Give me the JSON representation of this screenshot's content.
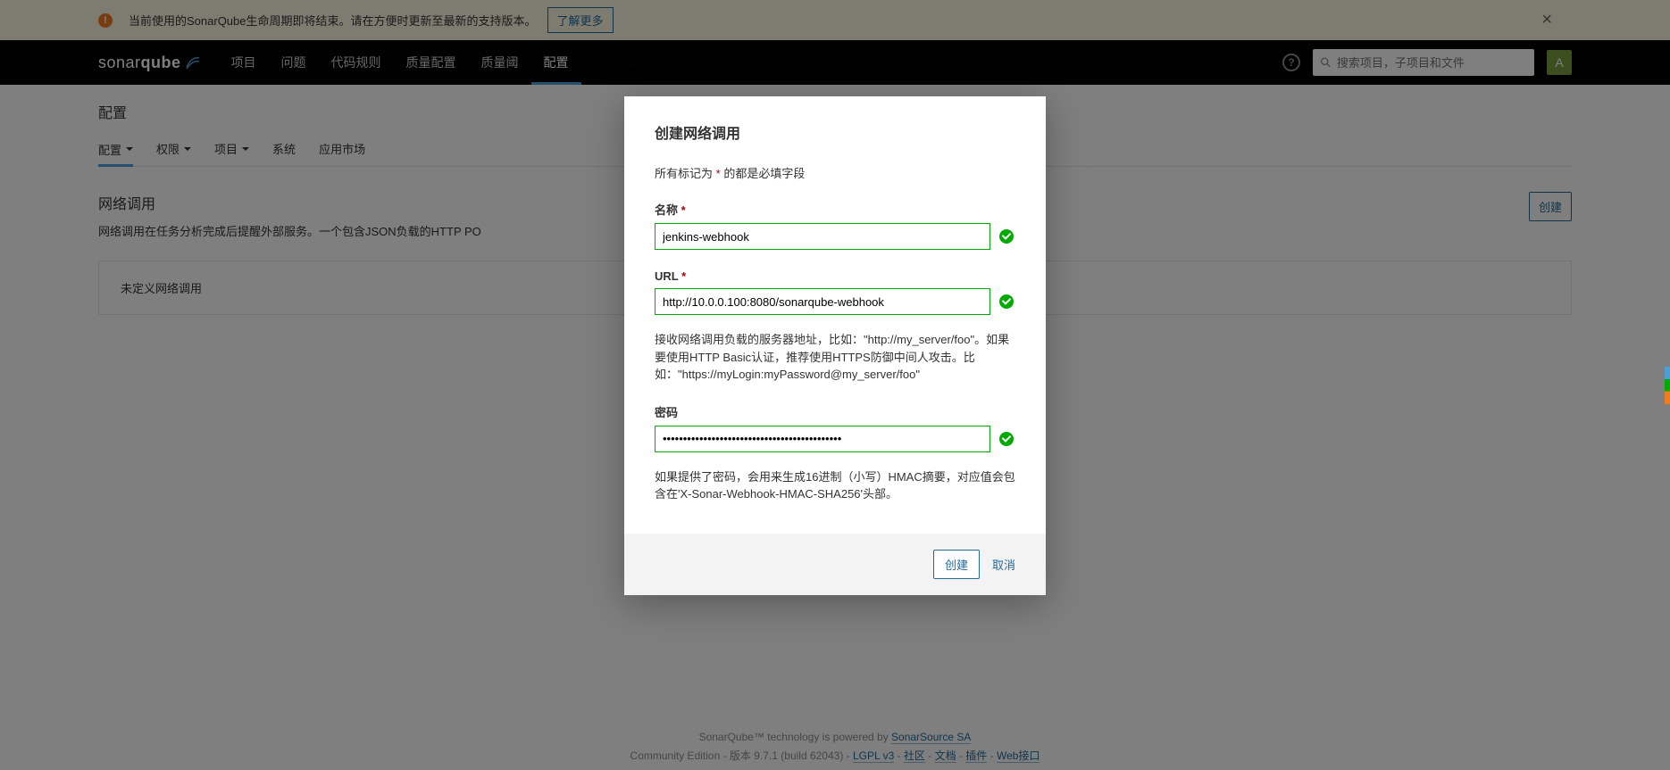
{
  "banner": {
    "text": "当前使用的SonarQube生命周期即将结束。请在方便时更新至最新的支持版本。",
    "learn_more": "了解更多"
  },
  "topnav": {
    "logo_part1": "sonar",
    "logo_part2": "qube",
    "items": [
      "项目",
      "问题",
      "代码规则",
      "质量配置",
      "质量阈",
      "配置"
    ],
    "active_index": 5,
    "search_placeholder": "搜索项目，子项目和文件",
    "avatar_letter": "A"
  },
  "page": {
    "title": "配置",
    "subnav": [
      "配置",
      "权限",
      "项目",
      "系统",
      "应用市场"
    ],
    "subnav_dropdown": [
      true,
      true,
      true,
      false,
      false
    ],
    "subnav_active_index": 0,
    "section_title": "网络调用",
    "section_desc": "网络调用在任务分析完成后提醒外部服务。一个包含JSON负载的HTTP PO",
    "create_button": "创建",
    "empty_message": "未定义网络调用"
  },
  "modal": {
    "title": "创建网络调用",
    "required_prefix": "所有标记为",
    "required_suffix": "的都是必填字段",
    "name_label": "名称",
    "name_value": "jenkins-webhook",
    "url_label": "URL",
    "url_value": "http://10.0.0.100:8080/sonarqube-webhook",
    "url_help": "接收网络调用负载的服务器地址，比如：\"http://my_server/foo\"。如果要使用HTTP Basic认证，推荐使用HTTPS防御中间人攻击。比如：\"https://myLogin:myPassword@my_server/foo\"",
    "password_label": "密码",
    "password_value": "••••••••••••••••••••••••••••••••••••••••••••",
    "password_help": "如果提供了密码，会用来生成16进制（小写）HMAC摘要，对应值会包含在'X-Sonar-Webhook-HMAC-SHA256'头部。",
    "submit": "创建",
    "cancel": "取消"
  },
  "footer": {
    "line1_prefix": "SonarQube™ technology is powered by ",
    "line1_link": "SonarSource SA",
    "line2_prefix": "Community Edition - 版本 9.7.1 (build 62043) - ",
    "links": [
      "LGPL v3",
      "社区",
      "文档",
      "插件",
      "Web接口"
    ]
  }
}
